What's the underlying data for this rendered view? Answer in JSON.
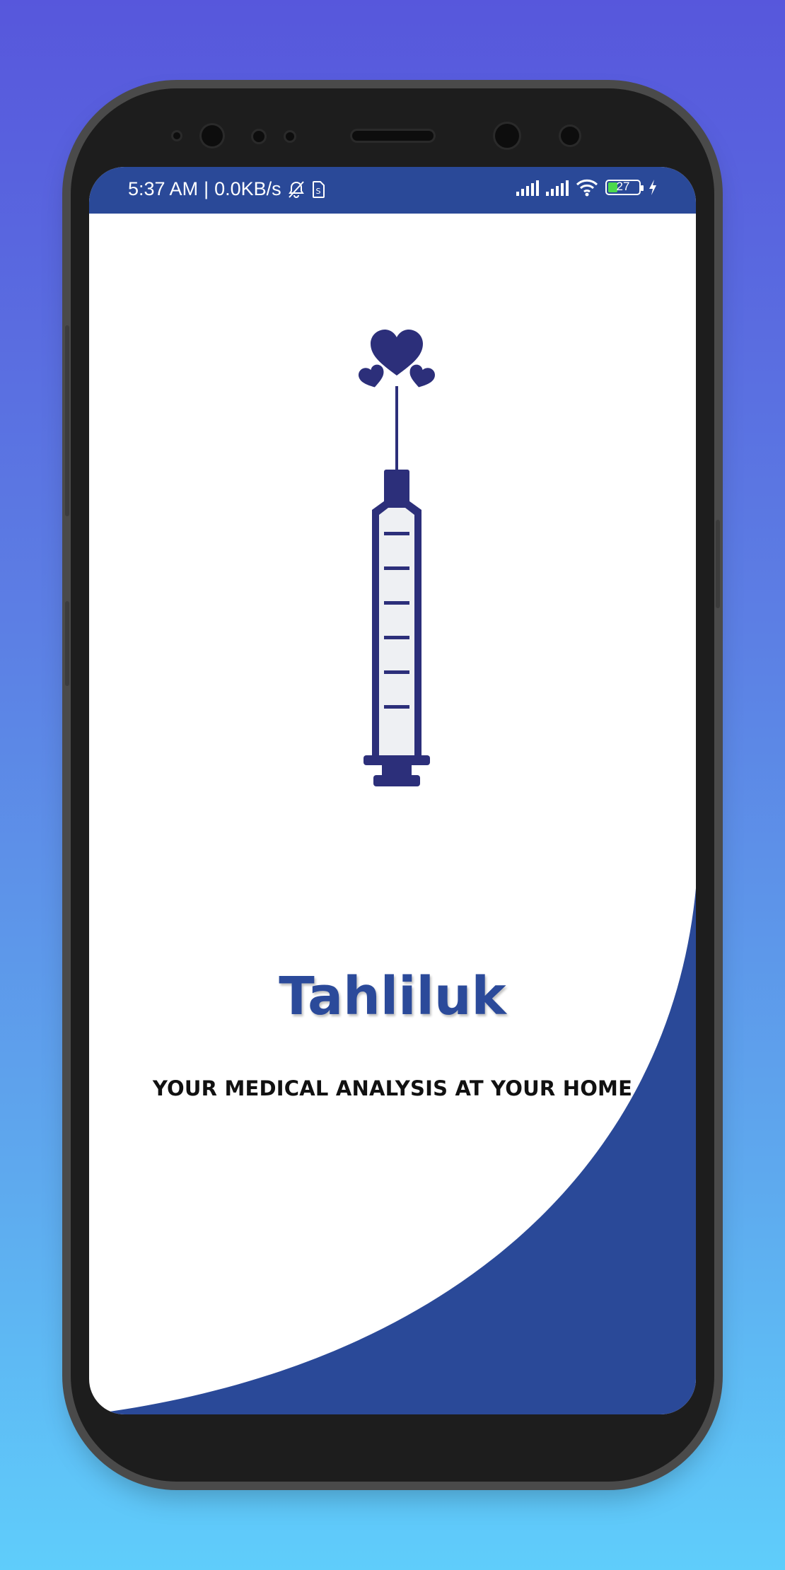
{
  "status_bar": {
    "time": "5:37 AM",
    "separator": "|",
    "speed": "0.0KB/s",
    "battery_level": "27",
    "icons": [
      "bell-off-icon",
      "sim-icon",
      "signal-icon",
      "signal-icon",
      "wifi-icon",
      "battery-icon",
      "charging-icon"
    ]
  },
  "app": {
    "name": "Tahliluk",
    "tagline": "YOUR MEDICAL ANALYSIS AT YOUR HOME",
    "logo_icon": "syringe-hearts-icon"
  },
  "colors": {
    "brand_blue": "#2a4998",
    "logo_navy": "#2c2f7a",
    "background_top": "#5757dc",
    "background_bottom": "#5fcdfb"
  }
}
